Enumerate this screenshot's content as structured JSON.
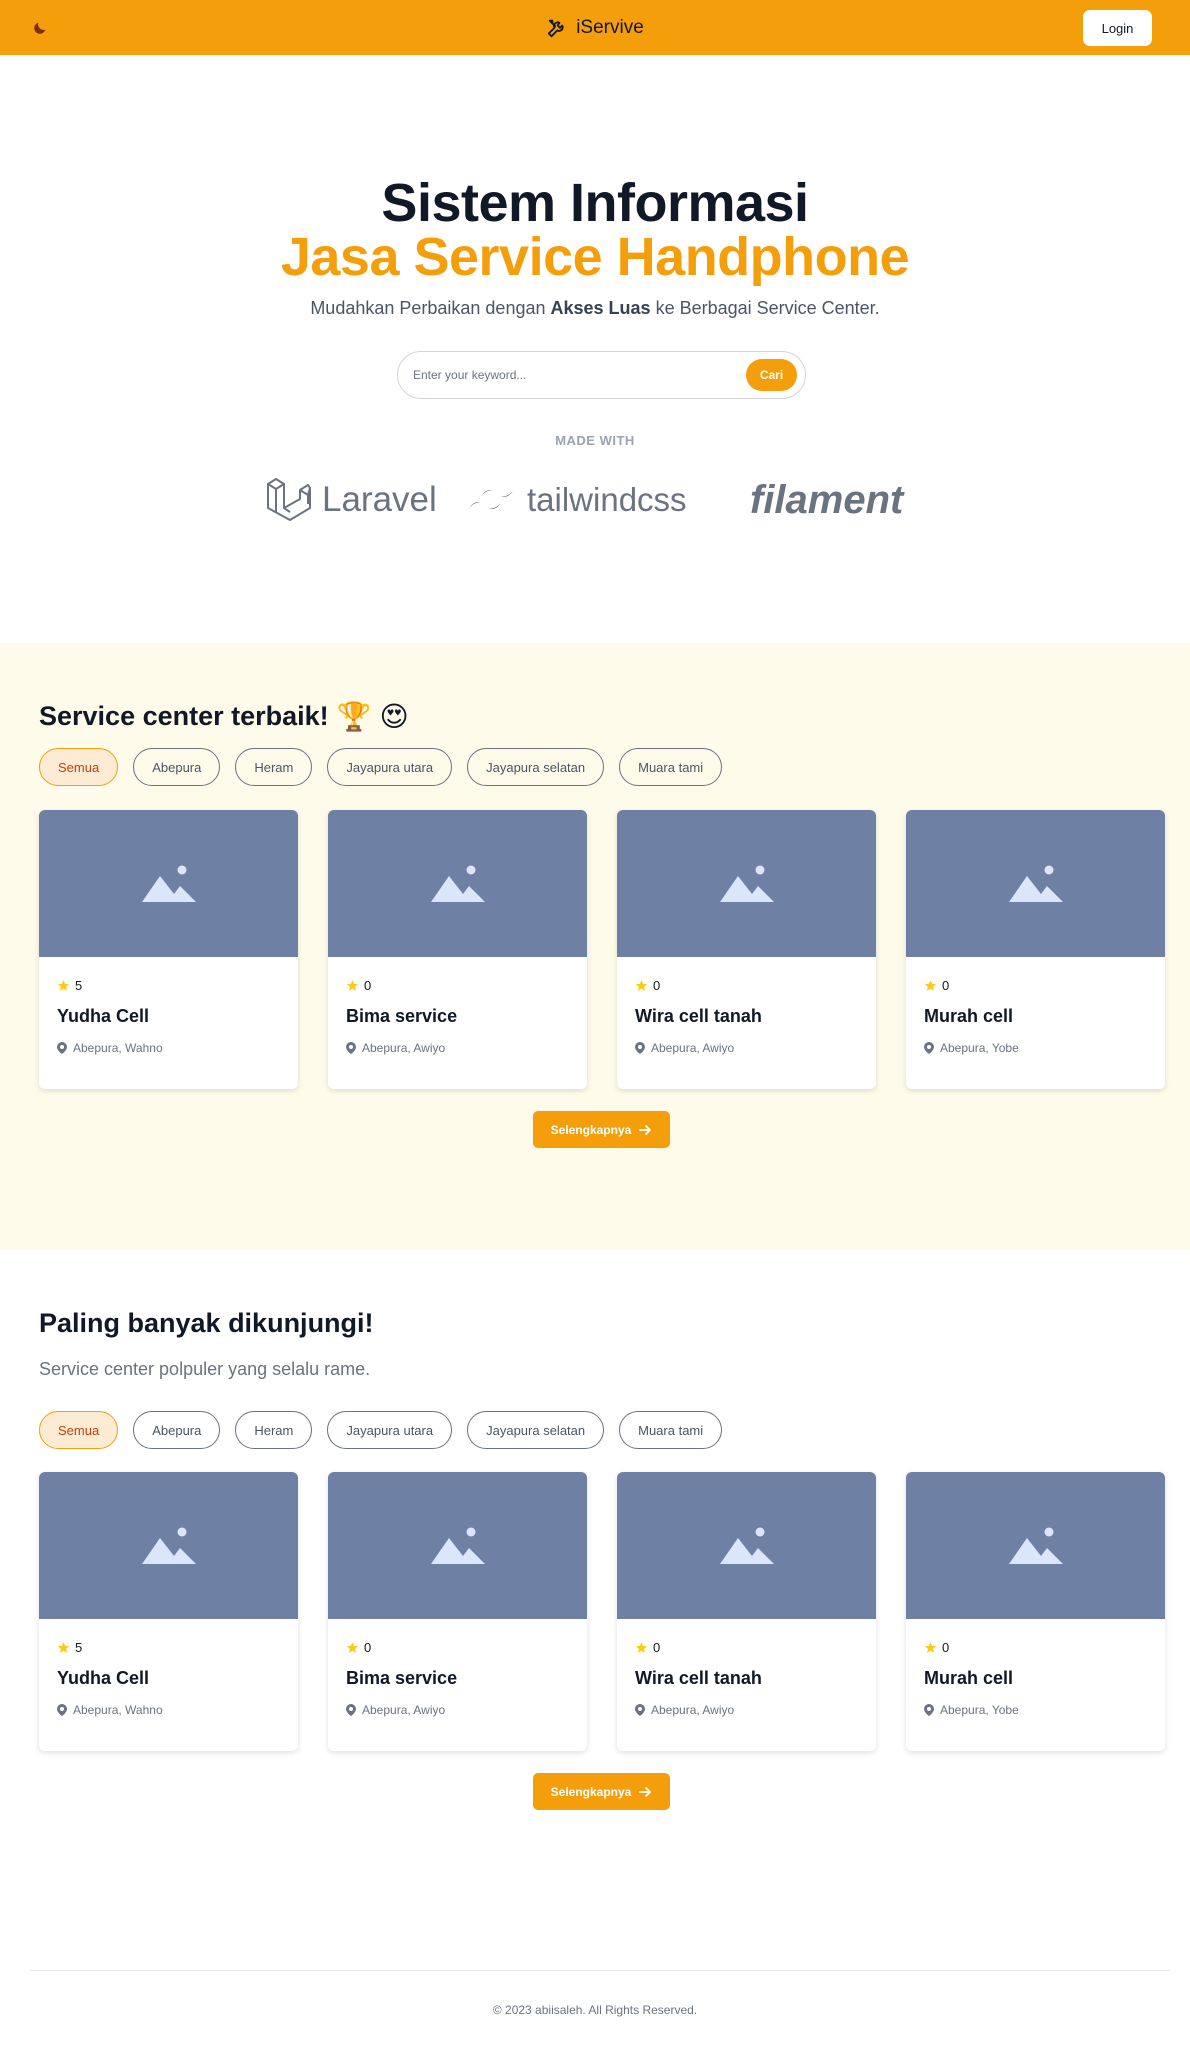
{
  "header": {
    "brand": "iServive",
    "login_label": "Login"
  },
  "hero": {
    "title_line1": "Sistem Informasi",
    "title_line2": "Jasa Service Handphone",
    "subtitle_pre": "Mudahkan Perbaikan dengan ",
    "subtitle_bold": "Akses Luas",
    "subtitle_post": " ke Berbagai Service Center.",
    "search_placeholder": "Enter your keyword...",
    "search_button": "Cari",
    "made_with": "MADE WITH",
    "logos": [
      "Laravel",
      "tailwindcss",
      "filament"
    ]
  },
  "filters": [
    "Semua",
    "Abepura",
    "Heram",
    "Jayapura utara",
    "Jayapura selatan",
    "Muara tami"
  ],
  "best": {
    "title": "Service center terbaik!",
    "emoji": [
      "🏆",
      "😍"
    ],
    "more_label": "Selengkapnya",
    "cards": [
      {
        "rating": "5",
        "name": "Yudha Cell",
        "location": "Abepura, Wahno"
      },
      {
        "rating": "0",
        "name": "Bima service",
        "location": "Abepura, Awiyo"
      },
      {
        "rating": "0",
        "name": "Wira cell tanah",
        "location": "Abepura, Awiyo"
      },
      {
        "rating": "0",
        "name": "Murah cell",
        "location": "Abepura, Yobe"
      }
    ]
  },
  "popular": {
    "title": "Paling banyak dikunjungi!",
    "subtitle": "Service center polpuler yang selalu rame.",
    "more_label": "Selengkapnya",
    "cards": [
      {
        "rating": "5",
        "name": "Yudha Cell",
        "location": "Abepura, Wahno"
      },
      {
        "rating": "0",
        "name": "Bima service",
        "location": "Abepura, Awiyo"
      },
      {
        "rating": "0",
        "name": "Wira cell tanah",
        "location": "Abepura, Awiyo"
      },
      {
        "rating": "0",
        "name": "Murah cell",
        "location": "Abepura, Yobe"
      }
    ]
  },
  "footer": {
    "text": "© 2023 abiisaleh. All Rights Reserved."
  },
  "colors": {
    "accent": "#f59e0b",
    "section_bg": "#fefbea",
    "placeholder_img": "#6e80a4",
    "star": "#facc15"
  }
}
